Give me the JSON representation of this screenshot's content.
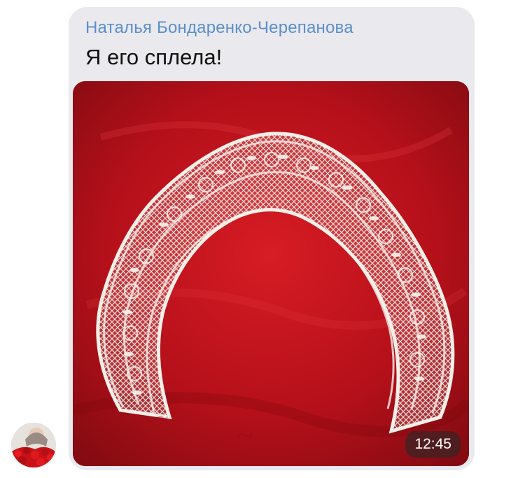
{
  "message": {
    "sender": "Наталья Бондаренко-Черепанова",
    "text": "Я его сплела!",
    "time": "12:45"
  },
  "colors": {
    "bubble": "#e9e9ee",
    "sender_name": "#5b8fc9",
    "photo_background": "#b5101a",
    "lace": "#f3efe8"
  },
  "icons": {
    "avatar": "profile-photo"
  }
}
